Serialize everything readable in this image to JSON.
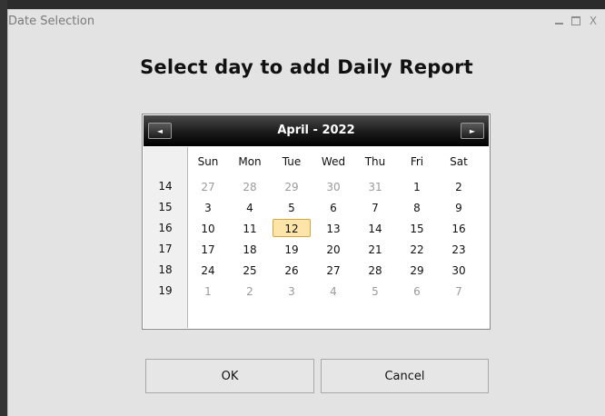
{
  "window": {
    "title": "Date Selection",
    "controls": {
      "minimize": "_",
      "maximize": "□",
      "close": "X"
    }
  },
  "heading": "Select day to add Daily Report",
  "calendar": {
    "month_label": "April - 2022",
    "prev_glyph": "◄",
    "next_glyph": "►",
    "days_of_week": [
      "Sun",
      "Mon",
      "Tue",
      "Wed",
      "Thu",
      "Fri",
      "Sat"
    ],
    "weeks": [
      {
        "week": "14",
        "days": [
          {
            "d": "27",
            "out": true
          },
          {
            "d": "28",
            "out": true
          },
          {
            "d": "29",
            "out": true
          },
          {
            "d": "30",
            "out": true
          },
          {
            "d": "31",
            "out": true
          },
          {
            "d": "1"
          },
          {
            "d": "2"
          }
        ]
      },
      {
        "week": "15",
        "days": [
          {
            "d": "3"
          },
          {
            "d": "4"
          },
          {
            "d": "5"
          },
          {
            "d": "6"
          },
          {
            "d": "7"
          },
          {
            "d": "8"
          },
          {
            "d": "9"
          }
        ]
      },
      {
        "week": "16",
        "days": [
          {
            "d": "10"
          },
          {
            "d": "11"
          },
          {
            "d": "12",
            "selected": true
          },
          {
            "d": "13"
          },
          {
            "d": "14"
          },
          {
            "d": "15"
          },
          {
            "d": "16"
          }
        ]
      },
      {
        "week": "17",
        "days": [
          {
            "d": "17"
          },
          {
            "d": "18"
          },
          {
            "d": "19"
          },
          {
            "d": "20"
          },
          {
            "d": "21"
          },
          {
            "d": "22"
          },
          {
            "d": "23"
          }
        ]
      },
      {
        "week": "18",
        "days": [
          {
            "d": "24"
          },
          {
            "d": "25"
          },
          {
            "d": "26"
          },
          {
            "d": "27"
          },
          {
            "d": "28"
          },
          {
            "d": "29"
          },
          {
            "d": "30"
          }
        ]
      },
      {
        "week": "19",
        "days": [
          {
            "d": "1",
            "out": true
          },
          {
            "d": "2",
            "out": true
          },
          {
            "d": "3",
            "out": true
          },
          {
            "d": "4",
            "out": true
          },
          {
            "d": "5",
            "out": true
          },
          {
            "d": "6",
            "out": true
          },
          {
            "d": "7",
            "out": true
          }
        ]
      }
    ],
    "selected_color": "#fde4a9"
  },
  "buttons": {
    "ok": "OK",
    "cancel": "Cancel"
  }
}
